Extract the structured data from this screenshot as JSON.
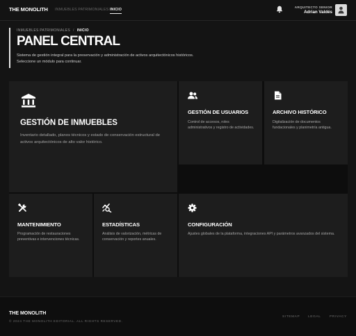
{
  "nav": {
    "brand": "THE MONOLITH",
    "links": [
      {
        "label": "INMUEBLES PATRIMONIALES",
        "active": false
      },
      {
        "label": "INICIO",
        "active": true
      }
    ],
    "bell_icon": "bell-icon",
    "user": {
      "role": "ARQUITECTO SENIOR",
      "name": "Adrian Valdés",
      "avatar_icon": "person-icon"
    }
  },
  "header": {
    "breadcrumb": [
      "INMUEBLES PATRIMONIALES",
      "INICIO"
    ],
    "breadcrumb_sep": "/",
    "title": "PANEL CENTRAL",
    "description": "Sistema de gestión integral para la preservación y administración de activos arquitectónicos históricos. Seleccione un módulo para continuar."
  },
  "modules": [
    {
      "title": "GESTIÓN DE INMUEBLES",
      "description": "Inventario detallado, planos técnicos y estado de conservación estructural de activos arquitectónicos de alto valor histórico.",
      "icon": "bank-icon"
    },
    {
      "title": "GESTIÓN DE USUARIOS",
      "description": "Control de accesos, roles administrativos y registro de actividades.",
      "icon": "people-icon"
    },
    {
      "title": "ARCHIVO HISTÓRICO",
      "description": "Digitalización de documentos fundacionales y planimetría antigua.",
      "icon": "document-icon"
    },
    {
      "title": "MANTENIMIENTO",
      "description": "Programación de restauraciones preventivas e intervenciones técnicas.",
      "icon": "tools-icon"
    },
    {
      "title": "ESTADÍSTICAS",
      "description": "Análisis de valorización, métricas de conservación y reportes anuales.",
      "icon": "analytics-icon"
    },
    {
      "title": "CONFIGURACIÓN",
      "description": "Ajustes globales de la plataforma, integraciones API y parámetros avanzados del sistema.",
      "icon": "gear-icon"
    }
  ],
  "footer": {
    "brand": "THE MONOLITH",
    "copyright": "© 2024 THE MONOLITH EDITORIAL. ALL RIGHTS RESERVED.",
    "links": [
      "SITEMAP",
      "LEGAL",
      "PRIVACY"
    ]
  }
}
